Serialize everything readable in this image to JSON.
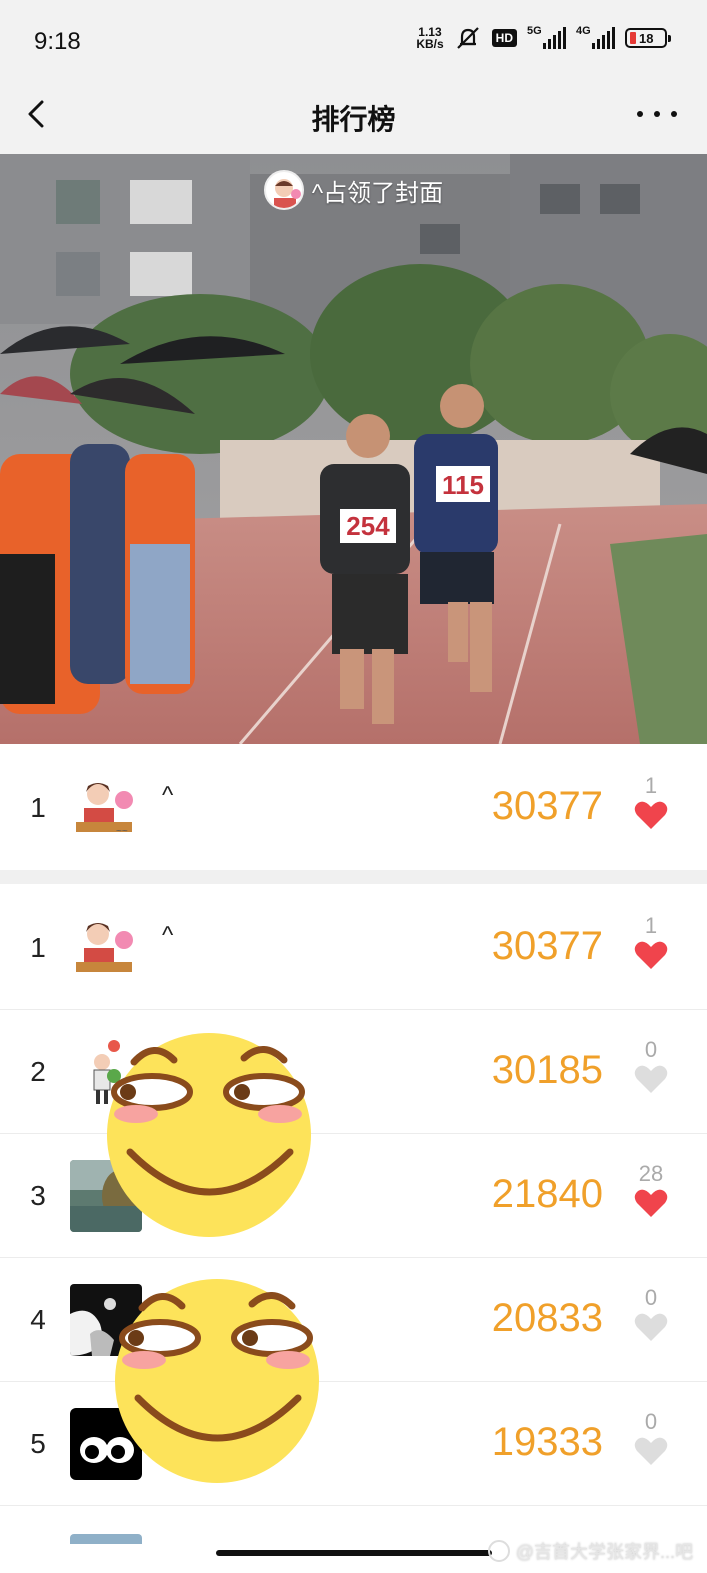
{
  "status_bar": {
    "time": "9:18",
    "net_speed_value": "1.13",
    "net_speed_unit": "KB/s",
    "hd": "HD",
    "signal_1": "5G",
    "signal_2": "4G",
    "battery": "18"
  },
  "nav": {
    "title": "排行榜"
  },
  "cover": {
    "caption": "^占领了封面",
    "bib_left": "254",
    "bib_right": "115"
  },
  "leader": {
    "rank": "1",
    "name": "^",
    "score": "30377",
    "likes": "1",
    "liked": true
  },
  "rankings": [
    {
      "rank": "1",
      "name": "^",
      "score": "30377",
      "likes": "1",
      "liked": true
    },
    {
      "rank": "2",
      "name": "",
      "score": "30185",
      "likes": "0",
      "liked": false
    },
    {
      "rank": "3",
      "name": "",
      "score": "21840",
      "likes": "28",
      "liked": true
    },
    {
      "rank": "4",
      "name": "",
      "score": "20833",
      "likes": "0",
      "liked": false
    },
    {
      "rank": "5",
      "name": "",
      "score": "19333",
      "likes": "0",
      "liked": false
    }
  ],
  "watermark": "@吉首大学张家界...吧",
  "colors": {
    "score": "#f0a02a",
    "heart_liked": "#f0444c",
    "heart_unliked": "#dddddd"
  }
}
